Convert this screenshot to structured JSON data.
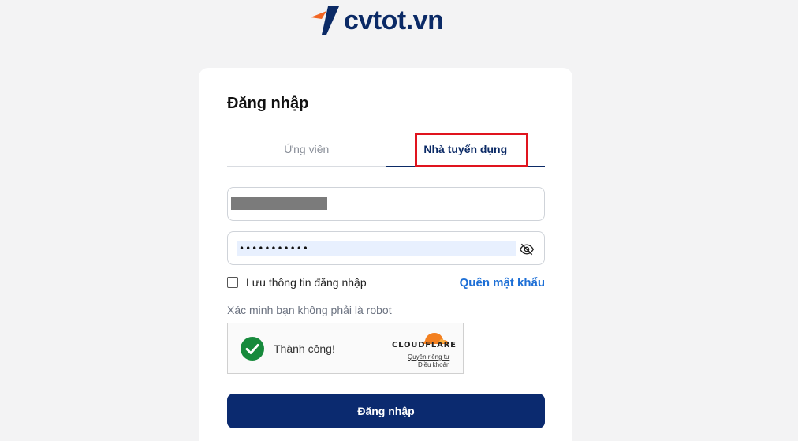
{
  "brand": {
    "logo_text": "cvtot.vn",
    "logo_color": "#0b2a66",
    "accent_color": "#f26522"
  },
  "login": {
    "title": "Đăng nhập",
    "tabs": [
      {
        "label": "Ứng viên",
        "active": false
      },
      {
        "label": "Nhà tuyển dụng",
        "active": true
      }
    ],
    "password_value": "•••••••••••",
    "remember_label": "Lưu thông tin đăng nhập",
    "remember_checked": false,
    "forgot_label": "Quên mật khẩu",
    "verify_label": "Xác minh bạn không phải là robot",
    "submit_label": "Đăng nhập"
  },
  "captcha": {
    "status": "Thành công!",
    "brand": "CLOUDFLARE",
    "privacy_link": "Quyền riêng tư",
    "terms_link": "Điều khoản"
  },
  "icons": {
    "logo_mark": "cvtot-logo-icon",
    "password_toggle": "eye-slash-icon",
    "captcha_success": "check-circle-icon",
    "cloudflare": "cloudflare-cloud-icon"
  }
}
